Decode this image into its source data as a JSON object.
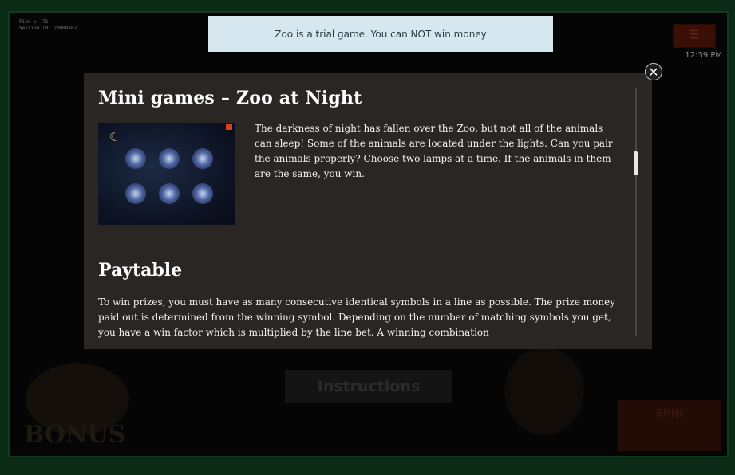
{
  "game": {
    "title": "Zoo",
    "session_line1": "Fine v. 72",
    "session_line2": "Session id: 20808882",
    "clock": "12:39 PM",
    "menu_icon": "hamburger-icon",
    "bonus_text": "BONUS",
    "instructions_label": "Instructions",
    "spin_label": "SPIN"
  },
  "notice": {
    "text": "Zoo is a trial game. You can NOT win money"
  },
  "modal": {
    "close_icon": "close-icon",
    "sections": {
      "mini_games": {
        "title": "Mini games – Zoo at Night",
        "description": "The darkness of night has fallen over the Zoo, but not all of the animals can sleep! Some of the animals are located under the lights. Can you pair the animals properly? Choose two lamps at a time. If the animals in them are the same, you win."
      },
      "paytable": {
        "title": "Paytable",
        "text": "To win prizes, you must have as many consecutive identical symbols in a line as possible. The prize money paid out is determined from the winning symbol. Depending on the number of matching symbols you get, you have a win factor which is multiplied by the line bet. A winning combination"
      }
    }
  },
  "colors": {
    "notice_bg": "#d6e7ef",
    "modal_bg": "#2a2624",
    "frame_border": "#0f3a20"
  }
}
